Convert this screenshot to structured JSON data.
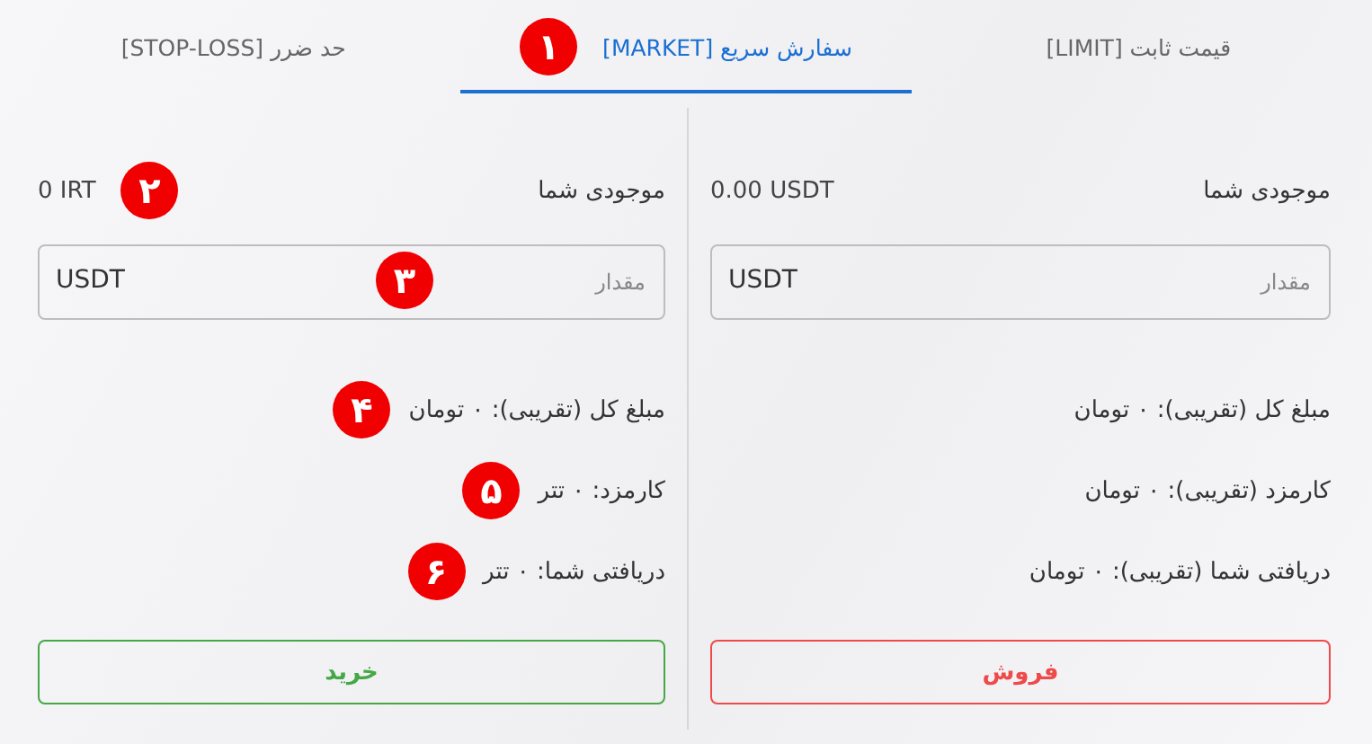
{
  "tabs": [
    {
      "label": "قیمت ثابت [LIMIT]",
      "selected": false
    },
    {
      "label": "سفارش سریع [MARKET]",
      "selected": true,
      "marker": "۱"
    },
    {
      "label": "حد ضرر [STOP-LOSS]",
      "selected": false
    }
  ],
  "panels": [
    {
      "kind": "sell",
      "balance_label": "موجودی شما",
      "balance_value": "0.00 USDT",
      "field": {
        "placeholder": "مقدار",
        "unit": "USDT"
      },
      "lines": [
        {
          "text": "مبلغ کل (تقریبی): ۰ تومان"
        },
        {
          "text": "کارمزد (تقریبی): ۰ تومان"
        },
        {
          "text": "دریافتی شما (تقریبی): ۰ تومان"
        }
      ],
      "button": "فروش"
    },
    {
      "kind": "buy",
      "balance_label": "موجودی شما",
      "balance_value": "0 IRT",
      "balance_marker": "۲",
      "field": {
        "placeholder": "مقدار",
        "unit": "USDT",
        "marker": "۳"
      },
      "lines": [
        {
          "text": "مبلغ کل (تقریبی): ۰ تومان",
          "marker": "۴"
        },
        {
          "text": "کارمزد: ۰ تتر",
          "marker": "۵"
        },
        {
          "text": "دریافتی شما: ۰ تتر",
          "marker": "۶"
        }
      ],
      "button": "خرید"
    }
  ]
}
